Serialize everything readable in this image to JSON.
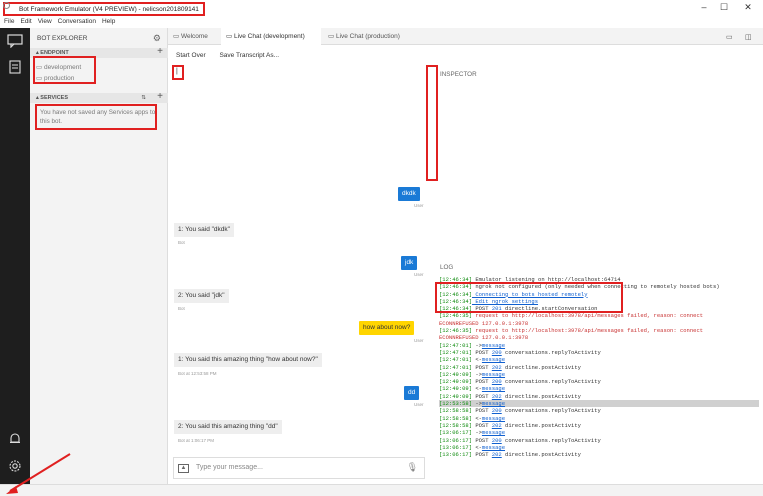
{
  "window": {
    "title": "Bot Framework Emulator (V4 PREVIEW) - nelicson201809141",
    "minimize": "–",
    "maximize": "☐",
    "close": "✕"
  },
  "menu": [
    "File",
    "Edit",
    "View",
    "Conversation",
    "Help"
  ],
  "explorer": {
    "title": "BOT EXPLORER",
    "endpoint_section": "ENDPOINT",
    "endpoints": [
      "development",
      "production"
    ],
    "services_section": "SERVICES",
    "services_sort": "⇅",
    "services_message": "You have not saved any Services apps to this bot."
  },
  "tabs": [
    {
      "label": "Welcome",
      "active": false
    },
    {
      "label": "Live Chat (development)",
      "active": true
    },
    {
      "label": "Live Chat (production)",
      "active": false
    }
  ],
  "chat": {
    "toolbar": [
      "Start Over",
      "Save Transcript As..."
    ],
    "cursor_char": "|",
    "messages": [
      {
        "from": "user",
        "text": "dkdk",
        "caption": "User"
      },
      {
        "from": "bot",
        "text": "1: You said \"dkdk\"",
        "caption": "Bot"
      },
      {
        "from": "user",
        "text": "jdk",
        "caption": "User"
      },
      {
        "from": "bot",
        "text": "2: You said \"jdk\"",
        "caption": "Bot"
      },
      {
        "from": "user",
        "text": "how about now?",
        "caption": "User"
      },
      {
        "from": "bot",
        "text": "1: You said this amazing thing \"how about now?\"",
        "caption": "Bot at 12:53:58 PM"
      },
      {
        "from": "user",
        "text": "dd",
        "caption": "User"
      },
      {
        "from": "bot",
        "text": "2: You said this amazing thing \"dd\"",
        "caption": "Bot at 1:06:17 PM"
      }
    ],
    "input_placeholder": "Type your message..."
  },
  "inspector": {
    "title": "INSPECTOR"
  },
  "log": {
    "title": "LOG",
    "lines": [
      {
        "ts": "[12:46:34]",
        "rest": " Emulator listening on http://localhost:64714",
        "kind": "plain"
      },
      {
        "ts": "[12:46:34]",
        "rest": " ngrok not configured (only needed when connecting to remotely hosted bots)",
        "kind": "plain"
      },
      {
        "ts": "[12:46:34]",
        "rest": " Connecting to bots hosted remotely",
        "kind": "link"
      },
      {
        "ts": "[12:46:34]",
        "rest": " Edit ngrok settings",
        "kind": "link"
      },
      {
        "ts": "[12:46:34]",
        "method": " POST ",
        "status": "201",
        "rest": " directline.startConversation",
        "kind": "req"
      },
      {
        "ts": "[12:46:35]",
        "rest": " request to http://localhost:3978/api/messages failed, reason: connect",
        "kind": "error"
      },
      {
        "ts": "",
        "rest": "ECONNREFUSED 127.0.0.1:3978",
        "kind": "error"
      },
      {
        "ts": "[12:46:35]",
        "rest": " request to http://localhost:3978/api/messages failed, reason: connect",
        "kind": "error"
      },
      {
        "ts": "",
        "rest": "ECONNREFUSED 127.0.0.1:3978",
        "kind": "error"
      },
      {
        "ts": "[12:47:01]",
        "arrow": " ->",
        "link": "message",
        "kind": "msg"
      },
      {
        "ts": "[12:47:01]",
        "method": " POST ",
        "status": "200",
        "rest": " conversations.replyToActivity",
        "kind": "req"
      },
      {
        "ts": "[12:47:01]",
        "arrow": " <-",
        "link": "message",
        "kind": "msg"
      },
      {
        "ts": "[12:47:01]",
        "method": " POST ",
        "status": "202",
        "rest": " directline.postActivity",
        "kind": "req"
      },
      {
        "ts": "[12:49:09]",
        "arrow": " ->",
        "link": "message",
        "kind": "msg"
      },
      {
        "ts": "[12:49:09]",
        "method": " POST ",
        "status": "200",
        "rest": " conversations.replyToActivity",
        "kind": "req"
      },
      {
        "ts": "[12:49:09]",
        "arrow": " <-",
        "link": "message",
        "kind": "msg"
      },
      {
        "ts": "[12:49:09]",
        "method": " POST ",
        "status": "202",
        "rest": " directline.postActivity",
        "kind": "req"
      },
      {
        "ts": "[12:53:58]",
        "arrow": " ->",
        "link": "message",
        "kind": "msg",
        "highlight": true
      },
      {
        "ts": "[12:58:58]",
        "method": " POST ",
        "status": "200",
        "rest": " conversations.replyToActivity",
        "kind": "req"
      },
      {
        "ts": "[12:58:58]",
        "arrow": " <-",
        "link": "message",
        "kind": "msg"
      },
      {
        "ts": "[12:58:58]",
        "method": " POST ",
        "status": "202",
        "rest": " directline.postActivity",
        "kind": "req"
      },
      {
        "ts": "[13:06:17]",
        "arrow": " ->",
        "link": "message",
        "kind": "msg"
      },
      {
        "ts": "[13:06:17]",
        "method": " POST ",
        "status": "200",
        "rest": " conversations.replyToActivity",
        "kind": "req"
      },
      {
        "ts": "[13:06:17]",
        "arrow": " <-",
        "link": "message",
        "kind": "msg"
      },
      {
        "ts": "[13:06:17]",
        "method": " POST ",
        "status": "202",
        "rest": " directline.postActivity",
        "kind": "req"
      }
    ]
  },
  "colors": {
    "accent": "#1a7ad6",
    "highlight_bubble": "#ffd500",
    "annotation_red": "#e02020",
    "activity_bar": "#1e1e1e"
  }
}
